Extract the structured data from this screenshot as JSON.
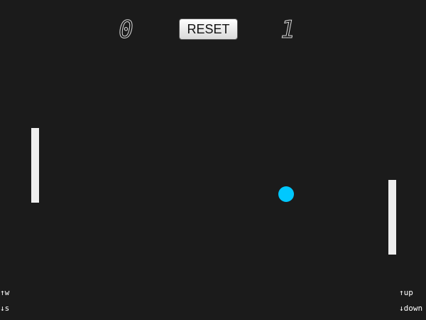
{
  "scoreboard": {
    "left_score": "0",
    "right_score": "1",
    "reset_label": "RESET"
  },
  "controls": {
    "left": {
      "up": "↑w",
      "down": "↓s"
    },
    "right": {
      "up": "↑up",
      "down": "↓down"
    }
  },
  "colors": {
    "background": "#1b1b1b",
    "paddle": "#eeeeee",
    "ball": "#00c8ff"
  }
}
